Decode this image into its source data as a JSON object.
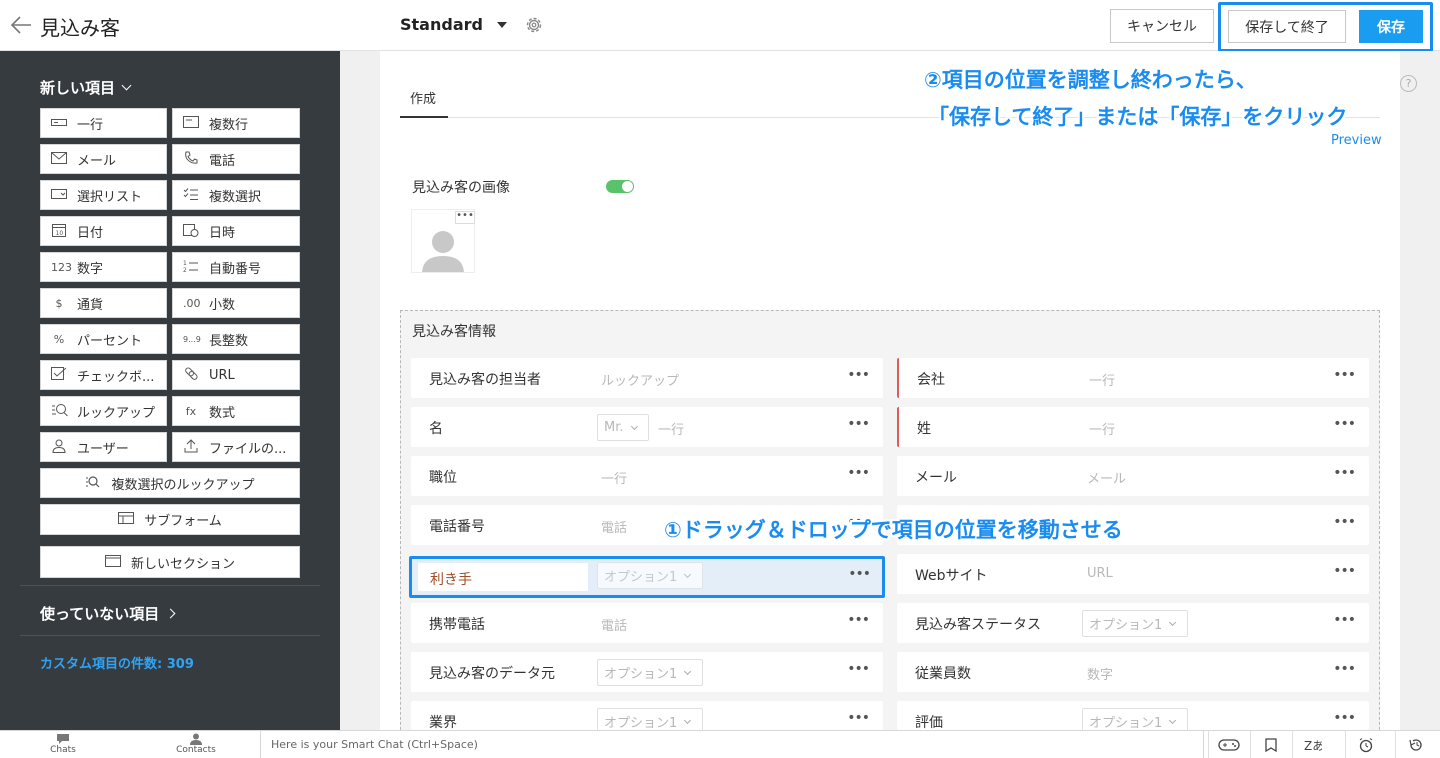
{
  "header": {
    "title": "見込み客",
    "layout": "Standard",
    "cancel_label": "キャンセル",
    "save_close_label": "保存して終了",
    "save_label": "保存"
  },
  "sidebar": {
    "new_items_heading": "新しい項目",
    "field_types": [
      {
        "label": "一行",
        "icon": "single-line-icon"
      },
      {
        "label": "複数行",
        "icon": "multi-line-icon"
      },
      {
        "label": "メール",
        "icon": "mail-icon"
      },
      {
        "label": "電話",
        "icon": "phone-icon"
      },
      {
        "label": "選択リスト",
        "icon": "picklist-icon"
      },
      {
        "label": "複数選択",
        "icon": "multiselect-icon"
      },
      {
        "label": "日付",
        "icon": "calendar-icon"
      },
      {
        "label": "日時",
        "icon": "datetime-icon"
      },
      {
        "label": "数字",
        "icon": "number-icon",
        "glyph": "123"
      },
      {
        "label": "自動番号",
        "icon": "autonumber-icon"
      },
      {
        "label": "通貨",
        "icon": "currency-icon",
        "glyph": "$"
      },
      {
        "label": "小数",
        "icon": "decimal-icon",
        "glyph": ".00"
      },
      {
        "label": "パーセント",
        "icon": "percent-icon",
        "glyph": "%"
      },
      {
        "label": "長整数",
        "icon": "long-integer-icon",
        "glyph": "9...9"
      },
      {
        "label": "チェックボ...",
        "icon": "checkbox-icon"
      },
      {
        "label": "URL",
        "icon": "link-icon"
      },
      {
        "label": "ルックアップ",
        "icon": "lookup-icon"
      },
      {
        "label": "数式",
        "icon": "formula-icon",
        "glyph": "fx"
      },
      {
        "label": "ユーザー",
        "icon": "user-icon"
      },
      {
        "label": "ファイルの...",
        "icon": "upload-icon"
      }
    ],
    "multi_lookup_label": "複数選択のルックアップ",
    "subform_label": "サブフォーム",
    "new_section_label": "新しいセクション",
    "unused_heading": "使っていない項目",
    "custom_count_label": "カスタム項目の件数: 309"
  },
  "main": {
    "tab_label": "作成",
    "preview_label": "Preview",
    "help_glyph": "?",
    "image_label": "見込み客の画像",
    "image_toggle_on": true,
    "section_title": "見込み客情報",
    "left_fields": [
      {
        "label": "見込み客の担当者",
        "placeholder": "ルックアップ"
      },
      {
        "label": "名",
        "select": "Mr.",
        "placeholder": "一行"
      },
      {
        "label": "職位",
        "placeholder": "一行"
      },
      {
        "label": "電話番号",
        "placeholder": "電話"
      },
      {
        "label": "利き手",
        "select": "オプション1"
      },
      {
        "label": "携帯電話",
        "placeholder": "電話"
      },
      {
        "label": "見込み客のデータ元",
        "select": "オプション1"
      },
      {
        "label": "業界",
        "select": "オプション1"
      }
    ],
    "right_fields": [
      {
        "label": "会社",
        "placeholder": "一行",
        "required": true
      },
      {
        "label": "姓",
        "placeholder": "一行",
        "required": true
      },
      {
        "label": "メール",
        "placeholder": "メール"
      },
      {
        "label": "",
        "placeholder": ""
      },
      {
        "label": "Webサイト",
        "placeholder": "URL"
      },
      {
        "label": "見込み客ステータス",
        "select": "オプション1"
      },
      {
        "label": "従業員数",
        "placeholder": "数字"
      },
      {
        "label": "評価",
        "select": "オプション1"
      }
    ],
    "dots": "•••"
  },
  "annotations": {
    "step2_line1": "②項目の位置を調整し終わったら、",
    "step2_line2": "「保存して終了」または「保存」をクリック",
    "step1": "①ドラッグ＆ドロップで項目の位置を移動させる"
  },
  "bottombar": {
    "chats_label": "Chats",
    "contacts_label": "Contacts",
    "smart_chat_placeholder": "Here is your Smart Chat (Ctrl+Space)"
  },
  "colors": {
    "accent": "#1a8cf0",
    "sidebar_bg": "#363b40",
    "toggle_on": "#58c36b",
    "required": "#e05a5a"
  }
}
